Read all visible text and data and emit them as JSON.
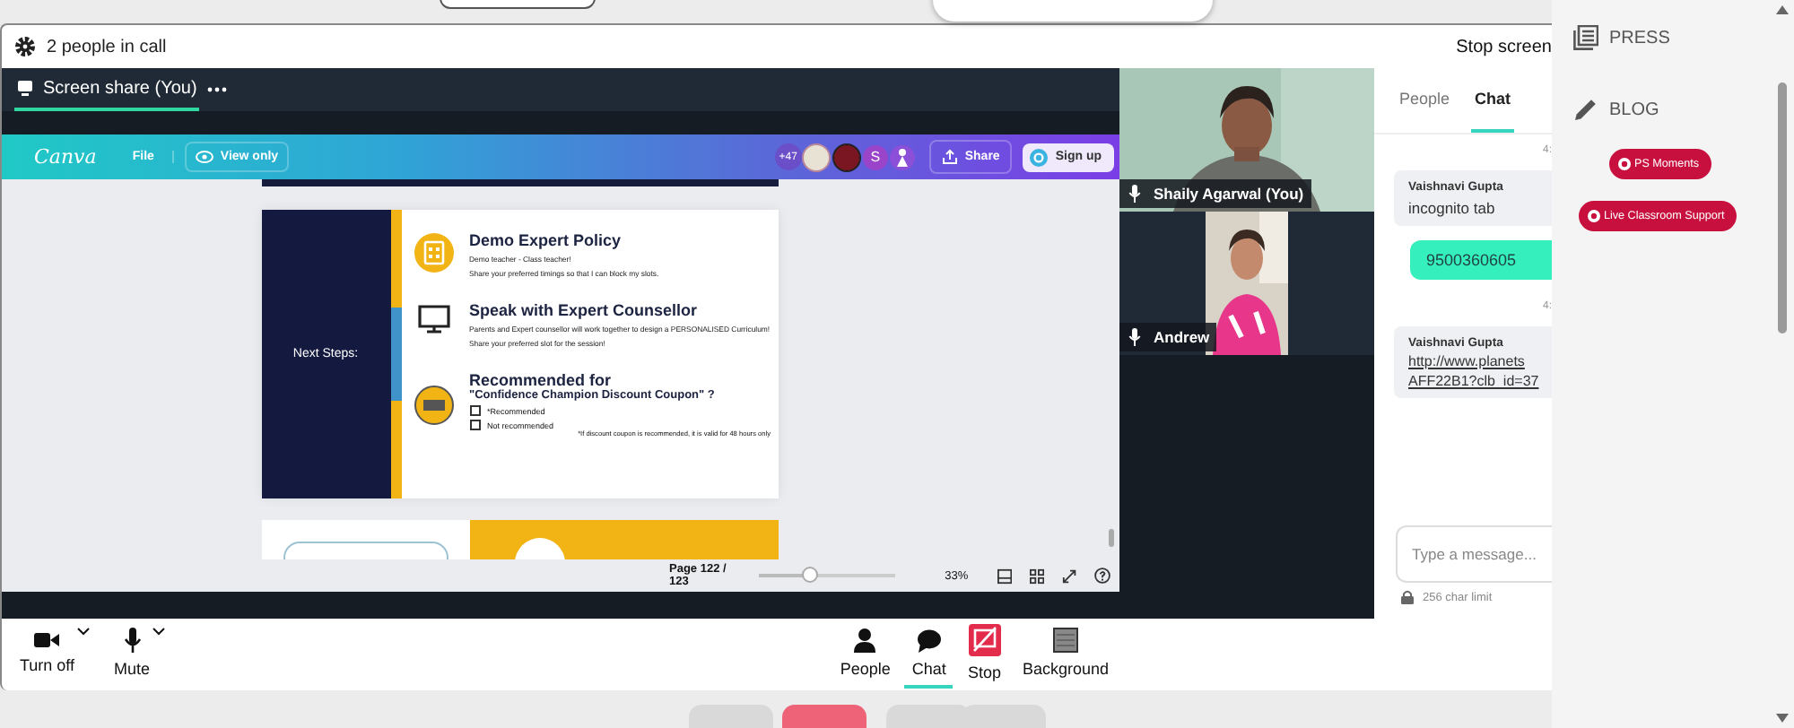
{
  "call_header": {
    "title": "2 people in call",
    "stop_button": "Stop screen"
  },
  "share_tab": {
    "label": "Screen share (You)",
    "selected": true
  },
  "canva": {
    "logo": "Canva",
    "file": "File",
    "view": "View only",
    "collaborators": "+47",
    "avatar_letter": "S",
    "share": "Share",
    "sign_up": "Sign up"
  },
  "slide": {
    "side_label": "Next Steps:",
    "sections": [
      {
        "kind": "calendar",
        "title": "Demo Expert Policy",
        "lines": [
          "Demo teacher - Class teacher!",
          "Share your preferred timings so that I can block my slots."
        ]
      },
      {
        "kind": "monitor",
        "title": "Speak with Expert Counsellor",
        "lines": [
          "Parents and Expert counsellor will work together to design a PERSONALISED Curriculum!",
          "Share your preferred slot for the session!"
        ]
      },
      {
        "kind": "coupon",
        "title": "Recommended for",
        "subtitle": "\"Confidence Champion Discount Coupon\" ?",
        "options": [
          {
            "label": "*Recommended",
            "checked": false
          },
          {
            "label": "Not recommended",
            "checked": false
          }
        ],
        "note": "*If discount coupon is recommended, it is valid for 48 hours only"
      }
    ]
  },
  "viewer_bar": {
    "page": "Page 122 / 123",
    "zoom": {
      "level": 0.37
    },
    "zoom_reading": "33%"
  },
  "videos": [
    {
      "name": "Shaily Agarwal (You)",
      "kind": "full"
    },
    {
      "name": "Andrew",
      "kind": "small"
    }
  ],
  "chat": {
    "tabs": [
      {
        "label": "People",
        "selected": false
      },
      {
        "label": "Chat",
        "selected": true
      }
    ],
    "messages": [
      {
        "kind": "time",
        "text": "4:"
      },
      {
        "kind": "message",
        "sender": "Vaishnavi Gupta",
        "text": "incognito tab"
      },
      {
        "kind": "own",
        "text": "9500360605"
      },
      {
        "kind": "time",
        "text": "4:"
      },
      {
        "kind": "link",
        "sender": "Vaishnavi Gupta",
        "lines": [
          "http://www.planets",
          "AFF22B1?clb_id=37"
        ]
      }
    ],
    "input": {
      "placeholder": "Type a message..."
    },
    "limit": "256 char limit"
  },
  "toolbar": {
    "left": [
      {
        "kind": "camera",
        "label": "Turn off"
      },
      {
        "kind": "mic",
        "label": "Mute"
      }
    ],
    "right": [
      {
        "kind": "people",
        "label": "People",
        "selected": false
      },
      {
        "kind": "chat",
        "label": "Chat",
        "selected": true
      },
      {
        "kind": "stop",
        "label": "Stop",
        "selected": false
      },
      {
        "kind": "background",
        "label": "Background",
        "selected": false
      }
    ]
  },
  "sidebar": {
    "links": [
      {
        "kind": "press",
        "label": "PRESS"
      },
      {
        "kind": "blog",
        "label": "BLOG"
      }
    ],
    "badges": [
      "PS Moments",
      "Live Classroom Support"
    ]
  }
}
